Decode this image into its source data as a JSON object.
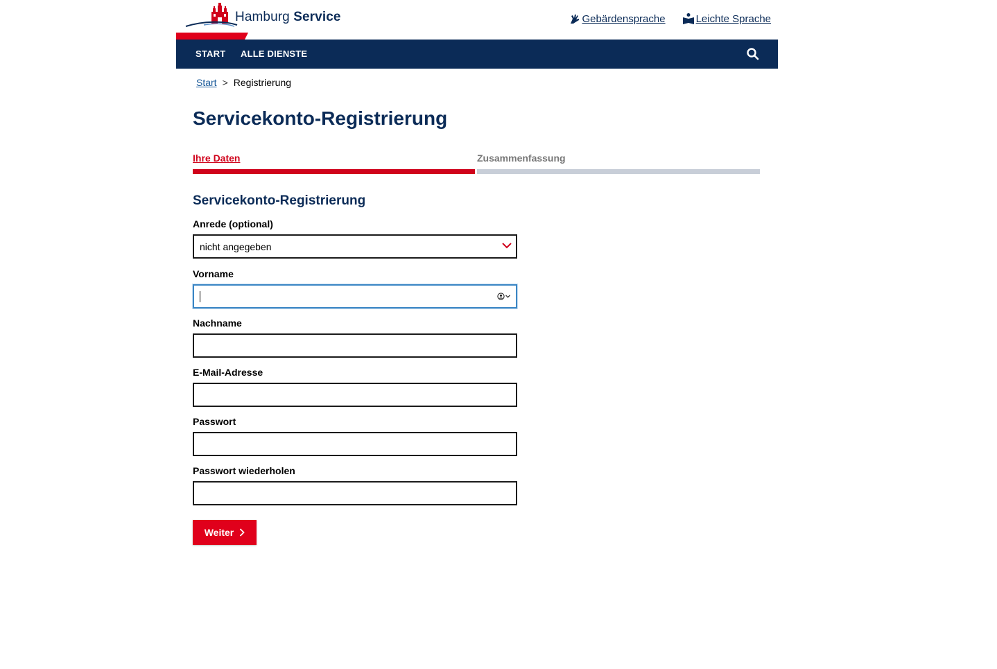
{
  "header": {
    "brand_light": "Hamburg ",
    "brand_bold": "Service",
    "links": [
      {
        "label": "Gebärdensprache",
        "icon": "sign-language-icon"
      },
      {
        "label": "Leichte Sprache",
        "icon": "easy-language-icon"
      }
    ]
  },
  "nav": {
    "items": [
      "START",
      "ALLE DIENSTE"
    ],
    "search_icon": "search-icon"
  },
  "breadcrumb": {
    "home": "Start",
    "separator": ">",
    "current": "Registrierung"
  },
  "page_title": "Servicekonto-Registrierung",
  "steps": [
    {
      "label": "Ihre Daten",
      "active": true
    },
    {
      "label": "Zusammenfassung",
      "active": false
    }
  ],
  "form": {
    "title": "Servicekonto-Registrierung",
    "salutation": {
      "label": "Anrede (optional)",
      "value": "nicht angegeben"
    },
    "first_name": {
      "label": "Vorname",
      "value": ""
    },
    "last_name": {
      "label": "Nachname",
      "value": ""
    },
    "email": {
      "label": "E-Mail-Adresse",
      "value": ""
    },
    "password": {
      "label": "Passwort",
      "value": ""
    },
    "password_repeat": {
      "label": "Passwort wiederholen",
      "value": ""
    },
    "submit_label": "Weiter"
  },
  "colors": {
    "brand_blue": "#0b2b57",
    "brand_red": "#e0001b",
    "inactive_step": "#c8ced8",
    "focus_border": "#3b86c4"
  }
}
